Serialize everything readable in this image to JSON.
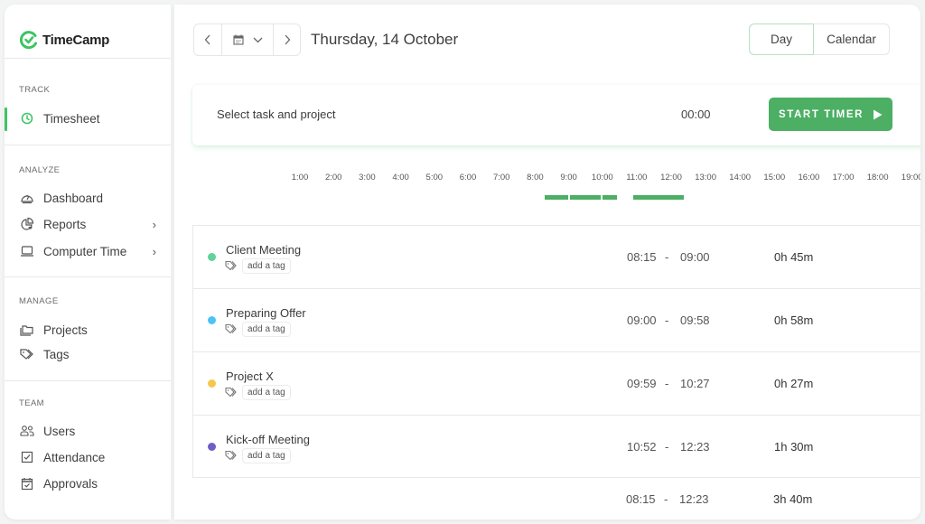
{
  "app": {
    "name": "TimeCamp",
    "brand_color": "#3ec464"
  },
  "sidebar": {
    "sections": [
      {
        "label": "TRACK",
        "items": [
          {
            "label": "Timesheet",
            "icon": "clock-icon",
            "active": true
          }
        ]
      },
      {
        "label": "ANALYZE",
        "items": [
          {
            "label": "Dashboard",
            "icon": "dashboard-gauge-icon"
          },
          {
            "label": "Reports",
            "icon": "pie-chart-icon",
            "has_submenu": true
          },
          {
            "label": "Computer Time",
            "icon": "laptop-icon",
            "has_submenu": true
          }
        ]
      },
      {
        "label": "MANAGE",
        "items": [
          {
            "label": "Projects",
            "icon": "folders-icon"
          },
          {
            "label": "Tags",
            "icon": "tags-icon"
          }
        ]
      },
      {
        "label": "TEAM",
        "items": [
          {
            "label": "Users",
            "icon": "users-icon"
          },
          {
            "label": "Attendance",
            "icon": "checkbox-icon"
          },
          {
            "label": "Approvals",
            "icon": "calendar-check-icon"
          }
        ]
      }
    ]
  },
  "header": {
    "date": "Thursday, 14 October",
    "views": [
      "Day",
      "Calendar"
    ],
    "active_view": "Day"
  },
  "timer": {
    "task_placeholder": "Select task and project",
    "elapsed": "00:00",
    "start_label": "START TIMER",
    "button_color": "#4caf64"
  },
  "timeline": {
    "hours": [
      "1:00",
      "2:00",
      "3:00",
      "4:00",
      "5:00",
      "6:00",
      "7:00",
      "8:00",
      "9:00",
      "10:00",
      "11:00",
      "12:00",
      "13:00",
      "14:00",
      "15:00",
      "16:00",
      "17:00",
      "18:00",
      "19:00"
    ],
    "hour_positions_note": "hours shown along the day timeline",
    "blocks": [
      {
        "start": "08:15",
        "end": "09:00"
      },
      {
        "start": "09:00",
        "end": "09:58"
      },
      {
        "start": "09:59",
        "end": "10:27"
      },
      {
        "start": "10:52",
        "end": "12:23"
      }
    ]
  },
  "entries": [
    {
      "name": "Client Meeting",
      "color": "#5fd39b",
      "tag_label": "add a tag",
      "start": "08:15",
      "end": "09:00",
      "duration": "0h 45m"
    },
    {
      "name": "Preparing Offer",
      "color": "#4cc3f5",
      "tag_label": "add a tag",
      "start": "09:00",
      "end": "09:58",
      "duration": "0h 58m"
    },
    {
      "name": "Project X",
      "color": "#f5c84c",
      "tag_label": "add a tag",
      "start": "09:59",
      "end": "10:27",
      "duration": "0h 27m"
    },
    {
      "name": "Kick-off Meeting",
      "color": "#6c5fc7",
      "tag_label": "add a tag",
      "start": "10:52",
      "end": "12:23",
      "duration": "1h 30m"
    }
  ],
  "total": {
    "start": "08:15",
    "end": "12:23",
    "duration": "3h 40m",
    "separator": "-"
  }
}
